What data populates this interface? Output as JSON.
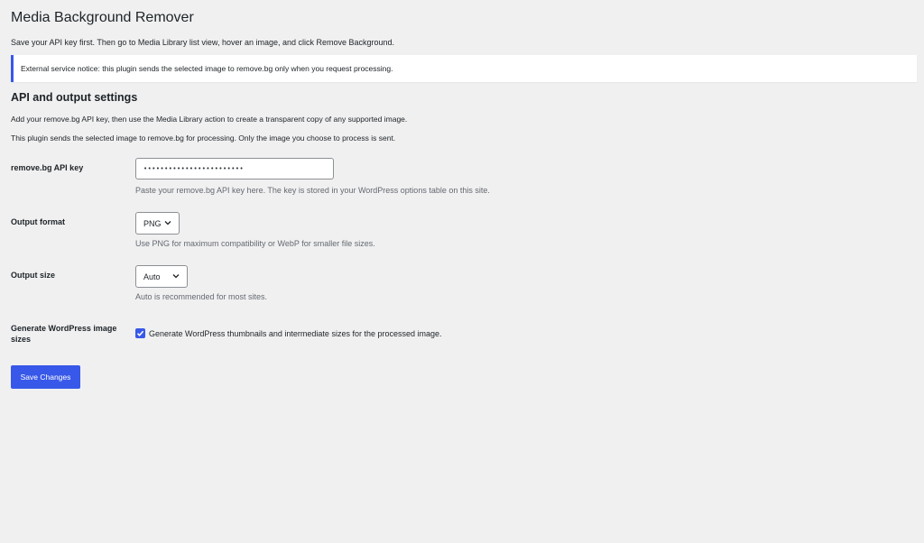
{
  "page": {
    "title": "Media Background Remover",
    "intro": "Save your API key first. Then go to Media Library list view, hover an image, and click Remove Background."
  },
  "notice": {
    "text": "External service notice: this plugin sends the selected image to remove.bg only when you request processing.",
    "border_color": "#3858e9"
  },
  "section": {
    "title": "API and output settings",
    "desc1": "Add your remove.bg API key, then use the Media Library action to create a transparent copy of any supported image.",
    "desc2": "This plugin sends the selected image to remove.bg for processing. Only the image you choose to process is sent."
  },
  "fields": {
    "api_key": {
      "label": "remove.bg API key",
      "value": "••••••••••••••••••••••••",
      "desc": "Paste your remove.bg API key here. The key is stored in your WordPress options table on this site."
    },
    "output_format": {
      "label": "Output format",
      "selected": "PNG",
      "desc": "Use PNG for maximum compatibility or WebP for smaller file sizes."
    },
    "output_size": {
      "label": "Output size",
      "selected": "Auto",
      "desc": "Auto is recommended for most sites."
    },
    "generate_sizes": {
      "label": "Generate WordPress image sizes",
      "checked": true,
      "checkbox_label": "Generate WordPress thumbnails and intermediate sizes for the processed image."
    }
  },
  "actions": {
    "save_label": "Save Changes"
  },
  "colors": {
    "accent": "#3858e9",
    "background": "#f0f0f1",
    "text": "#1d2327",
    "muted": "#646970"
  },
  "icons": {
    "select_chevron": "chevron-down-icon",
    "checkbox_check": "checkmark-icon"
  }
}
